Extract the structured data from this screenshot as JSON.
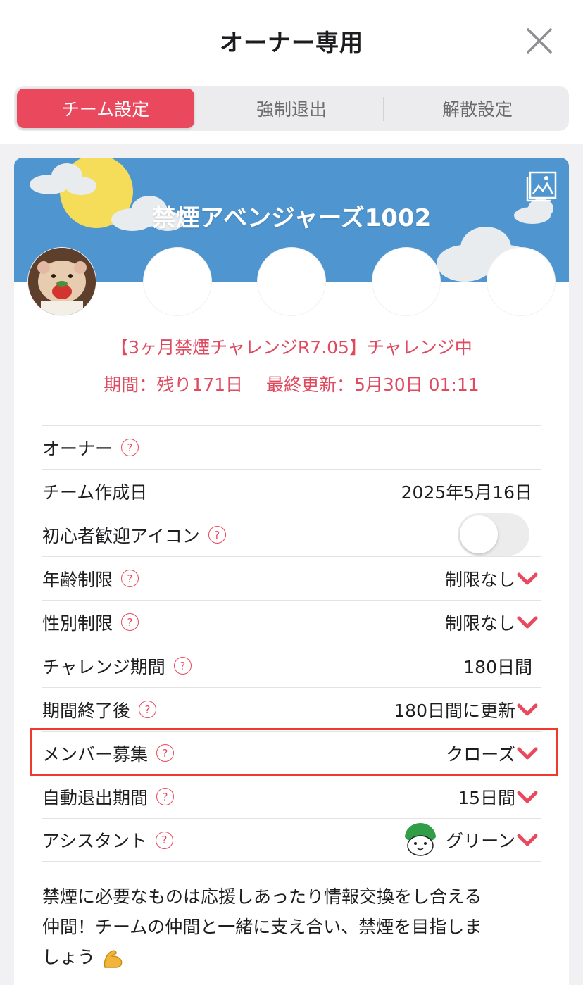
{
  "header": {
    "title": "オーナー専用"
  },
  "tabs": [
    {
      "label": "チーム設定"
    },
    {
      "label": "強制退出"
    },
    {
      "label": "解散設定"
    }
  ],
  "team": {
    "name": "禁煙アベンジャーズ1002",
    "status": "【3ヶ月禁煙チャレンジR7.05】チャレンジ中",
    "period": "期間：残り171日　 最終更新：5月30日 01:11"
  },
  "settings": [
    {
      "label": "オーナー",
      "value": ""
    },
    {
      "label": "チーム作成日",
      "value": "2025年5月16日"
    },
    {
      "label": "初心者歓迎アイコン",
      "value": "",
      "toggle_on": false
    },
    {
      "label": "年齢制限",
      "value": "制限なし"
    },
    {
      "label": "性別制限",
      "value": "制限なし"
    },
    {
      "label": "チャレンジ期間",
      "value": "180日間"
    },
    {
      "label": "期間終了後",
      "value": "180日間に更新"
    },
    {
      "label": "メンバー募集",
      "value": "クローズ"
    },
    {
      "label": "自動退出期間",
      "value": "15日間"
    },
    {
      "label": "アシスタント",
      "value": "グリーン"
    }
  ],
  "help_glyph": "?",
  "description": {
    "line1": "禁煙に必要なものは応援しあったり情報交換をし合える",
    "line2": "仲間！チームの仲間と一緒に支え合い、禁煙を目指しま",
    "line3": "しょう"
  },
  "colors": {
    "accent": "#e9485d",
    "banner": "#4f95cf",
    "highlight": "#ef3b2e"
  }
}
